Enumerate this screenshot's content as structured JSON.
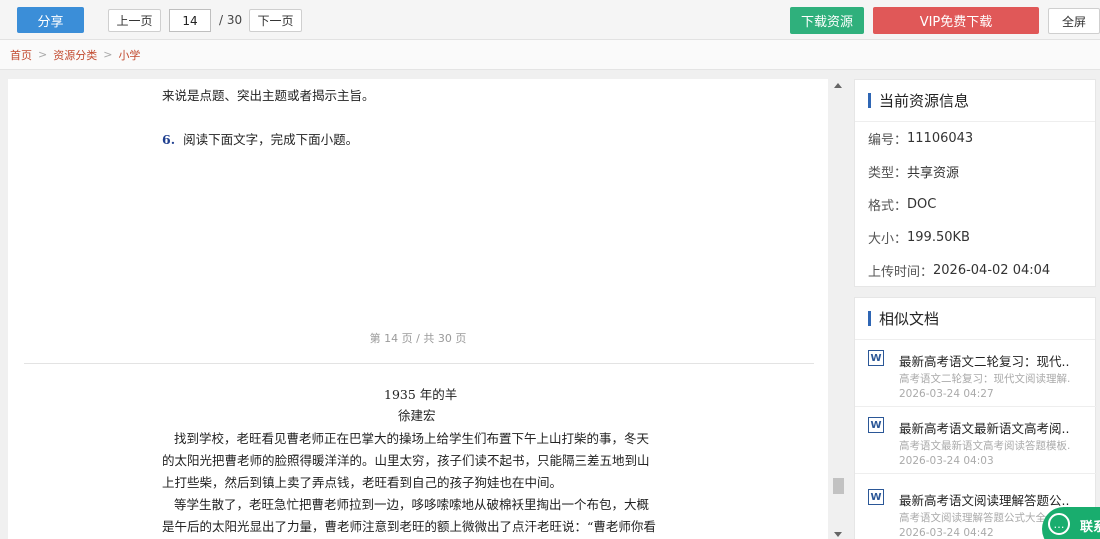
{
  "toolbar": {
    "share_label": "分享",
    "prev_label": "上一页",
    "page_current": "14",
    "page_total": "/ 30",
    "next_label": "下一页",
    "download_label": "下载资源",
    "vip_label": "VIP免费下载",
    "fullscreen_label": "全屏"
  },
  "breadcrumb": {
    "items": [
      "首页",
      "资源分类",
      "小学"
    ],
    "separator": ">"
  },
  "document": {
    "lines_top": [
      "来说是点题、突出主题或者揭示主旨。"
    ],
    "question": {
      "number": "6.",
      "text": "阅读下面文字，完成下面小题。"
    },
    "page_footer": "第 14 页 / 共 30 页",
    "article_title": "1935 年的羊",
    "article_author": "徐建宏",
    "paragraphs": [
      "找到学校，老旺看见曹老师正在巴掌大的操场上给学生们布置下午上山打柴的事，冬天",
      "的太阳光把曹老师的脸照得暖洋洋的。山里太穷，孩子们读不起书，只能隔三差五地到山",
      "上打些柴，然后到镇上卖了弄点钱，老旺看到自己的孩子狗娃也在中间。",
      "等学生散了，老旺急忙把曹老师拉到一边，哆哆嗦嗦地从破棉袄里掏出一个布包，大概",
      "是午后的太阳光显出了力量，曹老师注意到老旺的额上微微出了点汗老旺说：“曹老师你看"
    ]
  },
  "resource_info": {
    "title": "当前资源信息",
    "rows": [
      {
        "label": "编号：",
        "value": "11106043"
      },
      {
        "label": "类型：",
        "value": "共享资源"
      },
      {
        "label": "格式：",
        "value": "DOC"
      },
      {
        "label": "大小：",
        "value": "199.50KB"
      },
      {
        "label": "上传时间：",
        "value": "2026-04-02 04:04"
      }
    ]
  },
  "similar_docs": {
    "title": "相似文档",
    "items": [
      {
        "icon": "W",
        "title": "最新高考语文二轮复习：现代...",
        "subtitle": "高考语文二轮复习：现代文阅读理解...",
        "date": "2026-03-24 04:27"
      },
      {
        "icon": "W",
        "title": "最新高考语文最新语文高考阅...",
        "subtitle": "高考语文最新语文高考阅读答题模板...",
        "date": "2026-03-24 04:03"
      },
      {
        "icon": "W",
        "title": "最新高考语文阅读理解答题公...",
        "subtitle": "高考语文阅读理解答题公式大全",
        "date": "2026-03-24 04:42"
      }
    ]
  },
  "contact": {
    "label": "联系",
    "icon": "chat-icon"
  },
  "colors": {
    "share_blue": "#3b8ed8",
    "download_green": "#2fb07c",
    "vip_red": "#e05858",
    "breadcrumb_link": "#c24a2f",
    "panel_accent": "#2f66b4",
    "contact_green": "#19ad6e"
  }
}
